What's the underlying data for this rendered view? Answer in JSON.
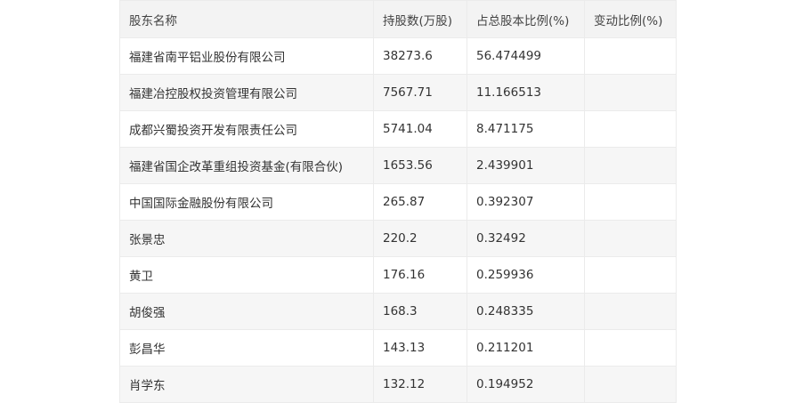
{
  "table": {
    "headers": [
      "股东名称",
      "持股数(万股)",
      "占总股本比例(%)",
      "变动比例(%)"
    ],
    "rows": [
      [
        "福建省南平铝业股份有限公司",
        "38273.6",
        "56.474499",
        ""
      ],
      [
        "福建冶控股权投资管理有限公司",
        "7567.71",
        "11.166513",
        ""
      ],
      [
        "成都兴蜀投资开发有限责任公司",
        "5741.04",
        "8.471175",
        ""
      ],
      [
        "福建省国企改革重组投资基金(有限合伙)",
        "1653.56",
        "2.439901",
        ""
      ],
      [
        "中国国际金融股份有限公司",
        "265.87",
        "0.392307",
        ""
      ],
      [
        "张景忠",
        "220.2",
        "0.32492",
        ""
      ],
      [
        "黄卫",
        "176.16",
        "0.259936",
        ""
      ],
      [
        "胡俊强",
        "168.3",
        "0.248335",
        ""
      ],
      [
        "彭昌华",
        "143.13",
        "0.211201",
        ""
      ],
      [
        "肖学东",
        "132.12",
        "0.194952",
        ""
      ]
    ]
  }
}
